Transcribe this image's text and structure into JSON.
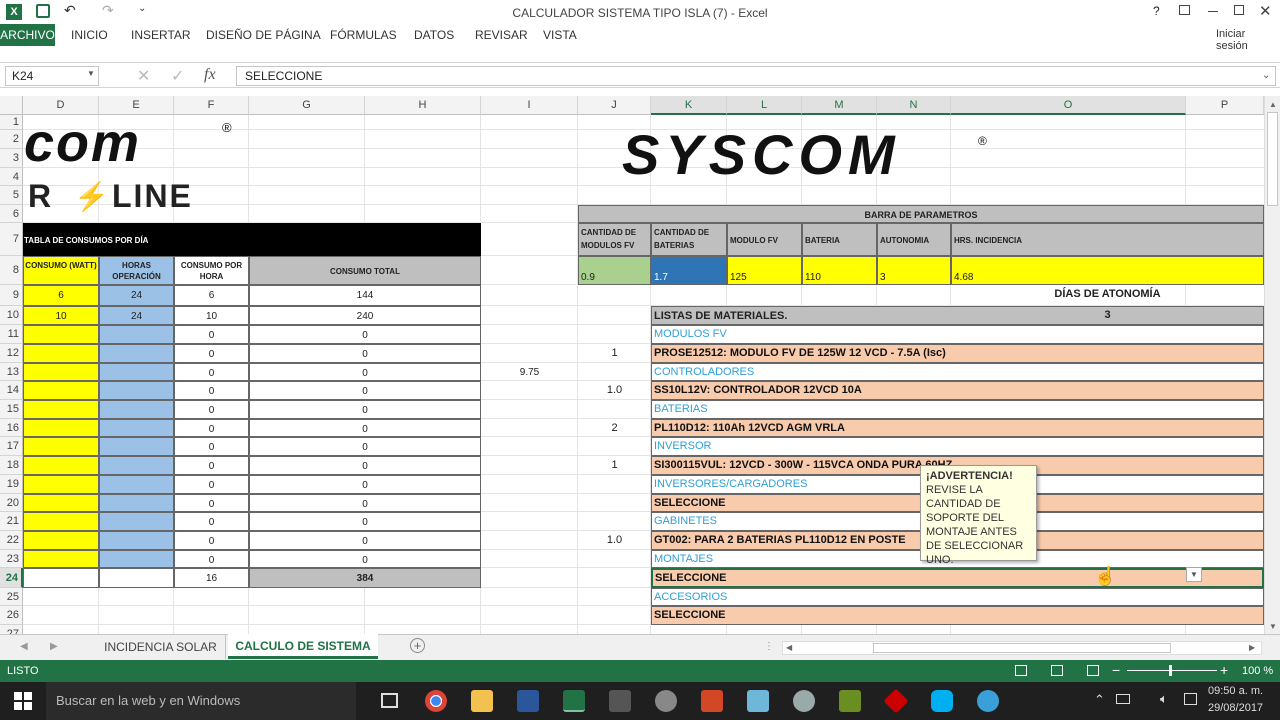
{
  "window": {
    "title": "CALCULADOR SISTEMA TIPO ISLA (7) - Excel",
    "help": "?",
    "signin": "Iniciar sesión"
  },
  "ribbon": {
    "tabs": [
      "ARCHIVO",
      "INICIO",
      "INSERTAR",
      "DISEÑO DE PÁGINA",
      "FÓRMULAS",
      "DATOS",
      "REVISAR",
      "VISTA"
    ]
  },
  "formula": {
    "cell_ref": "K24",
    "value": "SELECCIONE",
    "fx": "fx"
  },
  "columns": [
    "D",
    "E",
    "F",
    "G",
    "H",
    "I",
    "J",
    "K",
    "L",
    "M",
    "N",
    "O",
    "P"
  ],
  "rows": [
    "1",
    "2",
    "3",
    "4",
    "5",
    "6",
    "7",
    "8",
    "9",
    "10",
    "11",
    "12",
    "13",
    "14",
    "15",
    "16",
    "17",
    "18",
    "19",
    "20",
    "21",
    "22",
    "23",
    "24",
    "25",
    "26",
    "27"
  ],
  "logos": {
    "left_top": "com",
    "left_reg": "®",
    "left_bottom": "R",
    "left_line": "LINE",
    "right": "SYSCOM",
    "right_reg": "®"
  },
  "consumo_table": {
    "title": "TABLA DE CONSUMOS POR DÍA",
    "headers": [
      "CONSUMO (WATT)",
      "HORAS OPERACIÓN",
      "CONSUMO POR HORA",
      "CONSUMO TOTAL"
    ],
    "rows": [
      [
        "6",
        "24",
        "6",
        "144"
      ],
      [
        "10",
        "24",
        "10",
        "240"
      ],
      [
        "",
        "",
        "0",
        "0"
      ],
      [
        "",
        "",
        "0",
        "0"
      ],
      [
        "",
        "",
        "0",
        "0"
      ],
      [
        "",
        "",
        "0",
        "0"
      ],
      [
        "",
        "",
        "0",
        "0"
      ],
      [
        "",
        "",
        "0",
        "0"
      ],
      [
        "",
        "",
        "0",
        "0"
      ],
      [
        "",
        "",
        "0",
        "0"
      ],
      [
        "",
        "",
        "0",
        "0"
      ],
      [
        "",
        "",
        "0",
        "0"
      ],
      [
        "",
        "",
        "0",
        "0"
      ],
      [
        "",
        "",
        "0",
        "0"
      ],
      [
        "",
        "",
        "0",
        "0"
      ]
    ],
    "total_hours": "16",
    "total": "384"
  },
  "h13": "9.75",
  "params": {
    "title": "BARRA DE PARAMETROS",
    "headers": [
      "CANTIDAD DE MODULOS FV",
      "CANTIDAD DE BATERIAS",
      "MODULO FV",
      "BATERIA",
      "AUTONOMIA",
      "HRS. INCIDENCIA"
    ],
    "values": [
      "0.9",
      "1.7",
      "125",
      "110",
      "3",
      "4.68"
    ]
  },
  "dias": {
    "label": "DÍAS DE ATONOMÍA",
    "value": "3"
  },
  "materials": {
    "title": "LISTAS DE MATERIALES.",
    "items": [
      {
        "qty": "",
        "text": "MODULOS FV",
        "type": "cat"
      },
      {
        "qty": "1",
        "text": "PROSE12512: MODULO FV DE 125W 12 VCD - 7.5A  (Isc)",
        "type": "item"
      },
      {
        "qty": "",
        "text": "CONTROLADORES",
        "type": "cat"
      },
      {
        "qty": "1.0",
        "text": "SS10L12V: CONTROLADOR 12VCD 10A",
        "type": "item"
      },
      {
        "qty": "",
        "text": "BATERIAS",
        "type": "cat"
      },
      {
        "qty": "2",
        "text": "PL110D12: 110Ah   12VCD AGM VRLA",
        "type": "item"
      },
      {
        "qty": "",
        "text": "INVERSOR",
        "type": "cat"
      },
      {
        "qty": "1",
        "text": "SI300115VUL: 12VCD - 300W - 115VCA ONDA PURA 60HZ",
        "type": "item"
      },
      {
        "qty": "",
        "text": "INVERSORES/CARGADORES",
        "type": "cat"
      },
      {
        "qty": "",
        "text": "SELECCIONE",
        "type": "item"
      },
      {
        "qty": "",
        "text": "GABINETES",
        "type": "cat"
      },
      {
        "qty": "1.0",
        "text": "GT002: PARA 2 BATERIAS PL110D12 EN POSTE",
        "type": "item"
      },
      {
        "qty": "",
        "text": "MONTAJES",
        "type": "cat"
      },
      {
        "qty": "",
        "text": "SELECCIONE",
        "type": "item"
      },
      {
        "qty": "",
        "text": "ACCESORIOS",
        "type": "cat"
      },
      {
        "qty": "",
        "text": "SELECCIONE",
        "type": "item"
      }
    ]
  },
  "tooltip": {
    "title": "¡ADVERTENCIA!",
    "body": "REVISE LA CANTIDAD DE SOPORTE DEL MONTAJE ANTES DE SELECCIONAR UNO."
  },
  "sheets": {
    "tabs": [
      "INCIDENCIA SOLAR",
      "CALCULO DE SISTEMA"
    ],
    "add": "+"
  },
  "status": {
    "state": "LISTO",
    "zoom": "100 %"
  },
  "taskbar": {
    "search": "Buscar en la web y en Windows",
    "time": "09:50 a. m.",
    "date": "29/08/2017"
  },
  "colors": {
    "excel_green": "#217346",
    "yellow": "#ffff00",
    "blue": "#9bc2e6",
    "green_cell": "#a9d08e",
    "dark_blue": "#2f75b5",
    "salmon": "#f8cbad",
    "gray": "#bfbfbf",
    "cat_text": "#2e9fd8"
  }
}
